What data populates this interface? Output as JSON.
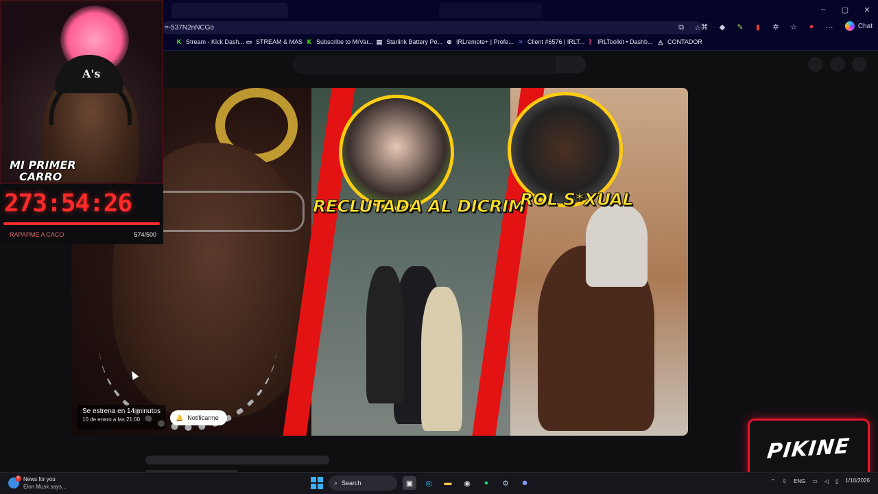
{
  "browser": {
    "url": "=-537N2nNCGo",
    "chat_label": "Chat",
    "window_controls": [
      "–",
      "▢",
      "✕"
    ],
    "bookmarks": [
      {
        "label": "Stream - Kick Dash...",
        "icon": "kick-icon",
        "color": "#53fc18",
        "glyph": "K"
      },
      {
        "label": "STREAM & MAS",
        "icon": "folder-icon",
        "color": "#e0e0ec",
        "glyph": "▭"
      },
      {
        "label": "Subscribe to MrVar...",
        "icon": "kick-icon",
        "color": "#53fc18",
        "glyph": "K"
      },
      {
        "label": "Starlink Battery Po...",
        "icon": "page-icon",
        "color": "#e0e0ec",
        "glyph": "▤"
      },
      {
        "label": "IRLremote+ | Profe...",
        "icon": "globe-icon",
        "color": "#e0e0ec",
        "glyph": "⊕"
      },
      {
        "label": "Client #6576 | IRLT...",
        "icon": "irlt-icon",
        "color": "#6f8cff",
        "glyph": "≈"
      },
      {
        "label": "IRLToolkit • Dashb...",
        "icon": "irltoolkit-icon",
        "color": "#ff4d6d",
        "glyph": "ᚱ"
      },
      {
        "label": "CONTADOR",
        "icon": "contador-icon",
        "color": "#e0e0ec",
        "glyph": "◬"
      }
    ]
  },
  "video": {
    "caption_mid": "RECLUTADA AL DICRIM",
    "caption_right": "ROL S*XUAL",
    "premiere_text": "Se estrena en 14 minutos",
    "premiere_date": "10 de enero a las 21:00",
    "notify_label": "Notificarme"
  },
  "overlay": {
    "cam_text_line1": "MI PRIMER",
    "cam_text_line2": "CARRO",
    "cap_logo": "A's",
    "timer": "273:54:26",
    "goal_label": "RAPAPME A CACO",
    "goal_count": "574/500",
    "goal_progress": 1.0,
    "brand": "PIKINE"
  },
  "taskbar": {
    "news_title": "News for you",
    "news_sub": "Elon Musk says...",
    "news_badge": "4",
    "search_label": "Search",
    "lang": "ENG",
    "date": "1/10/2026"
  },
  "colors": {
    "accent_red": "#e8142b",
    "caption_yellow": "#ffe027",
    "timer_red": "#ff2a2a"
  }
}
